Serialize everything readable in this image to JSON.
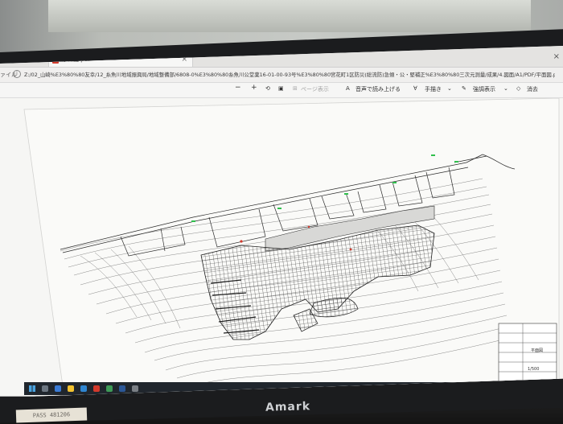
{
  "window": {
    "partial_tab": "ß",
    "tab_title": "平面図.pdf",
    "tab_close": "×",
    "window_close": "×"
  },
  "address": {
    "file_label": "ァイル",
    "path": "Z:/02_山崎%E3%80%80友幸/12_糸魚川地域振興局/地域整備部/6808-0%E3%80%80糸魚川公堂薬16-01-00-93号%E3%80%80宮花町1区防災(総流防)急傾・公・堅補正%E3%80%80三次元測量/成果/4.図面/A1/PDF/平面図.pdf"
  },
  "toolbar": {
    "minus": "−",
    "plus": "+",
    "page_display": "ページ表示",
    "read_aloud": "音声で読み上げる",
    "draw": "手描き",
    "erase_label": "消去",
    "view_label": "強調表示",
    "erase": "消去"
  },
  "title_block": {
    "header": "平面図",
    "scale": "1/500"
  },
  "monitor": {
    "brand": "Amark"
  },
  "sticker": {
    "text": "PASS 481206"
  },
  "colors": {
    "screen_bg": "#f6f6f4",
    "drawing_line": "#2b2b2b",
    "contour": "#7a7a7a",
    "accent_green": "#2fbf4c",
    "accent_red": "#d33a2c",
    "taskbar": "#20262d"
  }
}
